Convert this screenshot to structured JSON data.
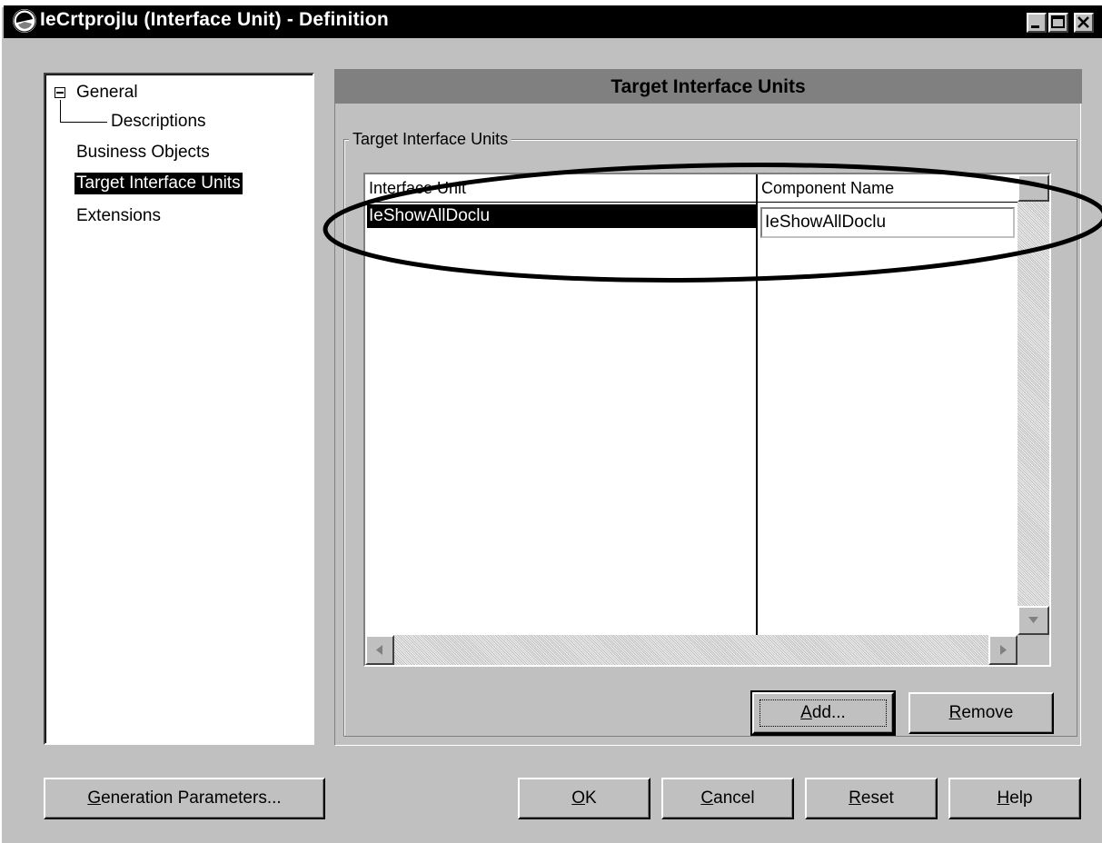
{
  "window": {
    "title": "IeCrtprojIu (Interface Unit) - Definition",
    "controls": {
      "minimize": "_",
      "maximize": "□",
      "close": "×"
    }
  },
  "tree": {
    "items": [
      {
        "label": "General",
        "expanded": true
      },
      {
        "label": "Descriptions"
      },
      {
        "label": "Business Objects"
      },
      {
        "label": "Target Interface Units",
        "selected": true
      },
      {
        "label": "Extensions"
      }
    ]
  },
  "panel": {
    "banner": "Target Interface Units",
    "group_label": "Target Interface Units"
  },
  "grid": {
    "columns": [
      "Interface Unit",
      "Component Name"
    ],
    "rows": [
      {
        "interface_unit": "IeShowAllDoclu",
        "component_name": "IeShowAllDoclu"
      }
    ]
  },
  "buttons": {
    "add": {
      "accel": "A",
      "rest": "dd..."
    },
    "remove": {
      "accel": "R",
      "rest": "emove"
    },
    "generation": {
      "accel": "G",
      "rest": "eneration Parameters..."
    },
    "ok": {
      "accel": "O",
      "rest": "K"
    },
    "cancel": {
      "accel": "C",
      "rest": "ancel"
    },
    "reset": {
      "accel": "R",
      "rest": "eset"
    },
    "help": {
      "accel": "H",
      "rest": "elp"
    }
  },
  "colors": {
    "face": "#c0c0c0",
    "titlebar": "#000000",
    "banner": "#808080",
    "selection": "#000000"
  }
}
